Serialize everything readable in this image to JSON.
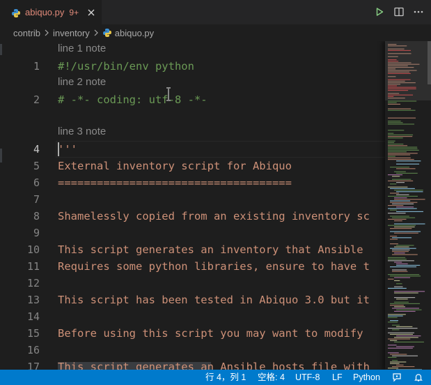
{
  "tab": {
    "filename": "abiquo.py",
    "badge": "9+"
  },
  "breadcrumb": {
    "folder1": "contrib",
    "folder2": "inventory",
    "file": "abiquo.py"
  },
  "notes": {
    "n1": "line 1 note",
    "n2": "line 2 note",
    "n3": "line 3 note"
  },
  "lines": [
    {
      "number": "1",
      "text": "#!/usr/bin/env python"
    },
    {
      "number": "2",
      "text": "# -*- coding: utf-8 -*-"
    },
    {
      "number": "4",
      "text": "'''"
    },
    {
      "number": "5",
      "text": "External inventory script for Abiquo"
    },
    {
      "number": "6",
      "text": "===================================="
    },
    {
      "number": "7",
      "text": ""
    },
    {
      "number": "8",
      "text": "Shamelessly copied from an existing inventory sc"
    },
    {
      "number": "9",
      "text": ""
    },
    {
      "number": "10",
      "text": "This script generates an inventory that Ansible"
    },
    {
      "number": "11",
      "text": "Requires some python libraries, ensure to have t"
    },
    {
      "number": "12",
      "text": ""
    },
    {
      "number": "13",
      "text": "This script has been tested in Abiquo 3.0 but it"
    },
    {
      "number": "14",
      "text": ""
    },
    {
      "number": "15",
      "text": "Before using this script you may want to modify"
    },
    {
      "number": "16",
      "text": ""
    },
    {
      "number": "17",
      "text": "This script generates an Ansible hosts file with"
    }
  ],
  "status": {
    "position": "行 4，列 1",
    "indent": "空格: 4",
    "encoding": "UTF-8",
    "eol": "LF",
    "language": "Python"
  },
  "colors": {
    "string": "#ce9178",
    "comment": "#6a9955",
    "status_bar": "#007acc",
    "tab_modified": "#e08a7a"
  },
  "icons": [
    "python-file-icon",
    "close-icon",
    "run-icon",
    "split-editor-icon",
    "more-actions-icon",
    "chevron-right-icon",
    "feedback-icon",
    "bell-icon"
  ]
}
